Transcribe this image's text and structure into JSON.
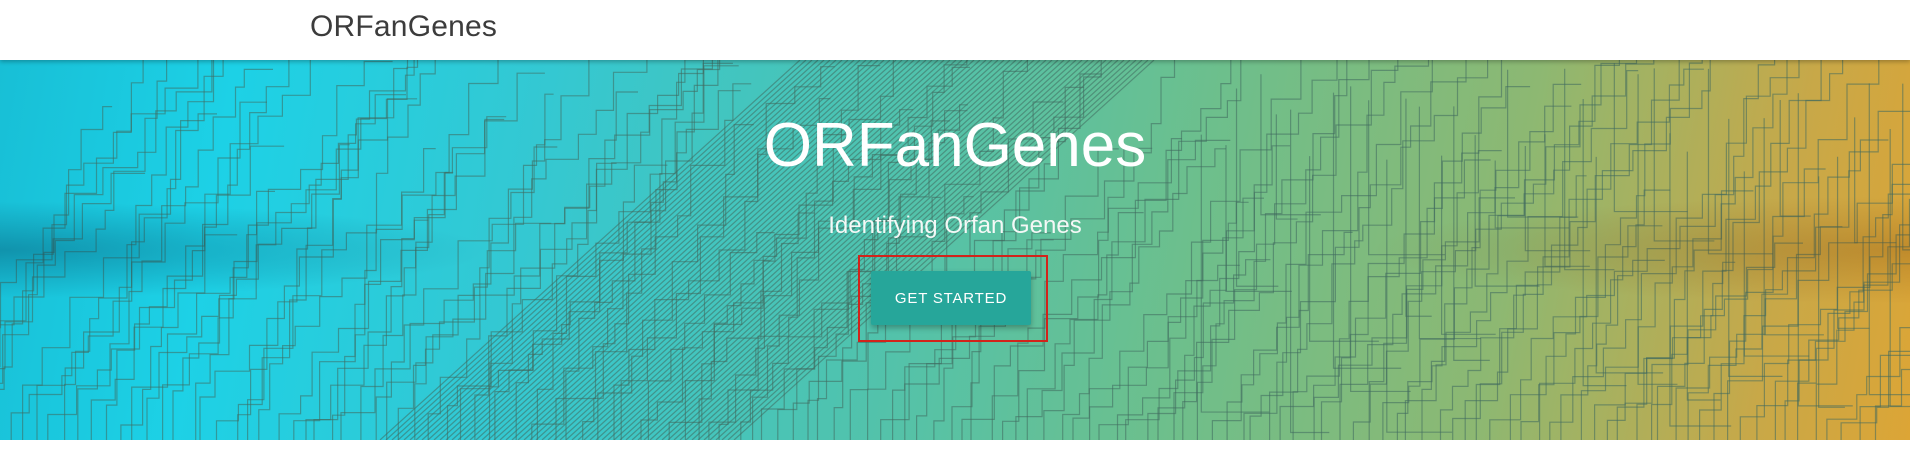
{
  "navbar": {
    "brand": "ORFanGenes"
  },
  "hero": {
    "title": "ORFanGenes",
    "subtitle": "Identifying Orfan Genes",
    "cta_label": "GET STARTED",
    "background_image": "phylogenetic-tree-background"
  },
  "colors": {
    "navbar_bg": "#ffffff",
    "brand_text": "#3c3c3c",
    "hero_gradient_start": "#1dd1e6",
    "hero_gradient_end": "#dca536",
    "button_bg": "#26a69a",
    "highlight_border": "#d2231b"
  }
}
